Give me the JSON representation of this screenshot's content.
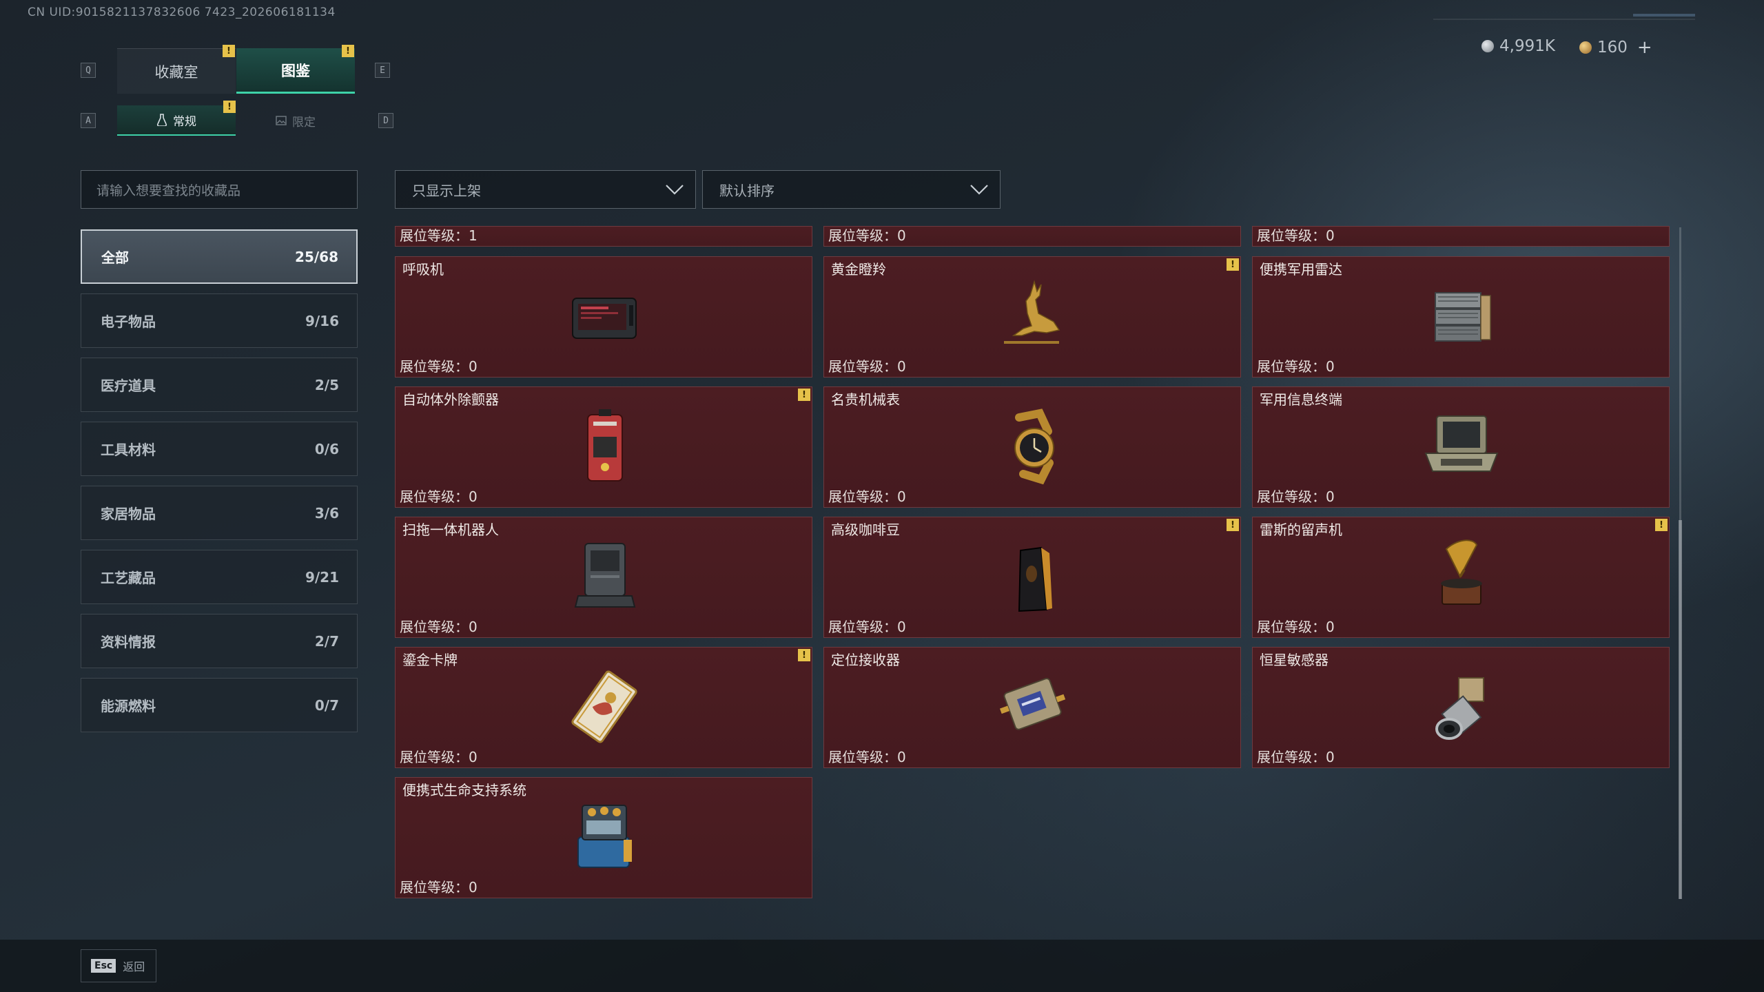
{
  "uid": "CN UID:9015821137832606 7423_202606181134",
  "tabs": {
    "left_key": "Q",
    "right_key": "E",
    "items": [
      {
        "label": "收藏室",
        "active": false
      },
      {
        "label": "图鉴",
        "active": true
      }
    ]
  },
  "subtabs": {
    "left_key": "A",
    "right_key": "D",
    "items": [
      {
        "label": "常规",
        "active": true
      },
      {
        "label": "限定",
        "active": false
      }
    ]
  },
  "warn_glyph": "!",
  "currency": {
    "silver": "4,991K",
    "gold": "160",
    "add": "+"
  },
  "search": {
    "placeholder": "请输入想要查找的收藏品"
  },
  "filters": {
    "display": "只显示上架",
    "sort": "默认排序"
  },
  "categories": [
    {
      "label": "全部",
      "count": "25/68"
    },
    {
      "label": "电子物品",
      "count": "9/16"
    },
    {
      "label": "医疗道具",
      "count": "2/5"
    },
    {
      "label": "工具材料",
      "count": "0/6"
    },
    {
      "label": "家居物品",
      "count": "3/6"
    },
    {
      "label": "工艺藏品",
      "count": "9/21"
    },
    {
      "label": "资料情报",
      "count": "2/7"
    },
    {
      "label": "能源燃料",
      "count": "0/7"
    }
  ],
  "partial_row": [
    {
      "level": "展位等级：1"
    },
    {
      "level": "展位等级：0"
    },
    {
      "level": "展位等级：0"
    }
  ],
  "items": [
    {
      "name": "呼吸机",
      "level": "展位等级：0",
      "flag": false,
      "icon": "ventilator-icon"
    },
    {
      "name": "黄金瞪羚",
      "level": "展位等级：0",
      "flag": true,
      "icon": "golden-gazelle-icon"
    },
    {
      "name": "便携军用雷达",
      "level": "展位等级：0",
      "flag": false,
      "icon": "radar-icon"
    },
    {
      "name": "自动体外除颤器",
      "level": "展位等级：0",
      "flag": true,
      "icon": "defibrillator-icon"
    },
    {
      "name": "名贵机械表",
      "level": "展位等级：0",
      "flag": false,
      "icon": "watch-icon"
    },
    {
      "name": "军用信息终端",
      "level": "展位等级：0",
      "flag": false,
      "icon": "terminal-icon"
    },
    {
      "name": "扫拖一体机器人",
      "level": "展位等级：0",
      "flag": false,
      "icon": "robot-vacuum-icon"
    },
    {
      "name": "高级咖啡豆",
      "level": "展位等级：0",
      "flag": true,
      "icon": "coffee-bag-icon"
    },
    {
      "name": "雷斯的留声机",
      "level": "展位等级：0",
      "flag": true,
      "icon": "gramophone-icon"
    },
    {
      "name": "鎏金卡牌",
      "level": "展位等级：0",
      "flag": true,
      "icon": "gold-card-icon"
    },
    {
      "name": "定位接收器",
      "level": "展位等级：0",
      "flag": false,
      "icon": "receiver-icon"
    },
    {
      "name": "恒星敏感器",
      "level": "展位等级：0",
      "flag": false,
      "icon": "star-sensor-icon"
    },
    {
      "name": "便携式生命支持系统",
      "level": "展位等级：0",
      "flag": false,
      "icon": "life-support-icon"
    }
  ],
  "footer": {
    "esc_key": "Esc",
    "back_label": "返回"
  }
}
